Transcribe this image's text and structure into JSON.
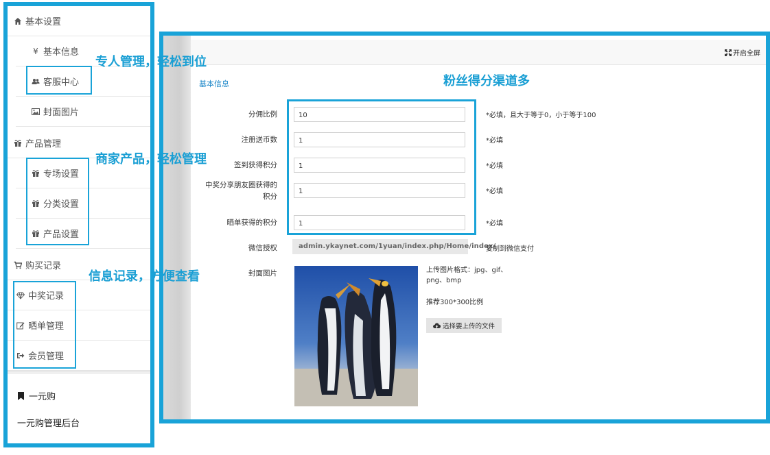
{
  "sidebar": {
    "basic_settings": "基本设置",
    "basic_info": "基本信息",
    "customer_service": "客服中心",
    "cover_image": "封面图片",
    "product_mgmt": "产品管理",
    "venue_settings": "专场设置",
    "category_settings": "分类设置",
    "product_settings": "产品设置",
    "purchase_records": "购买记录",
    "winning_records": "中奖记录",
    "share_mgmt": "晒单管理",
    "member_mgmt": "会员管理",
    "brand_title": "一元购",
    "brand_sub": "一元购管理后台"
  },
  "topbar": {
    "fullscreen_label": "开启全屏"
  },
  "form": {
    "section_title": "基本信息",
    "fields": [
      {
        "label": "分佣比例",
        "value": "10",
        "hint": "*必填，且大于等于0，小于等于100"
      },
      {
        "label": "注册送币数",
        "value": "1",
        "hint": "*必填"
      },
      {
        "label": "签到获得积分",
        "value": "1",
        "hint": "*必填"
      },
      {
        "label_line1": "中奖分享朋友圈获得的",
        "label_line2": "积分",
        "value": "1",
        "hint": "*必填"
      },
      {
        "label": "晒单获得的积分",
        "value": "1",
        "hint": "*必填"
      }
    ],
    "wechat_auth_label": "微信授权",
    "wechat_auth_url": "admin.ykaynet.com/1yuan/index.php/Home/index/",
    "copy_link": "复制到微信支付",
    "cover_label": "封面图片",
    "upload_format_line1": "上传图片格式：jpg、gif、",
    "upload_format_line2": "png、bmp",
    "upload_ratio": "推荐300*300比例",
    "upload_button": "选择要上传的文件"
  },
  "callouts": {
    "c1": "专人管理，轻松到位",
    "c2": "商家产品，轻松管理",
    "c3": "信息记录，方便查看",
    "c4": "粉丝得分渠道多"
  },
  "colors": {
    "accent": "#19a3d8",
    "callout": "#1a9fd4",
    "section_title": "#1a86c8"
  }
}
